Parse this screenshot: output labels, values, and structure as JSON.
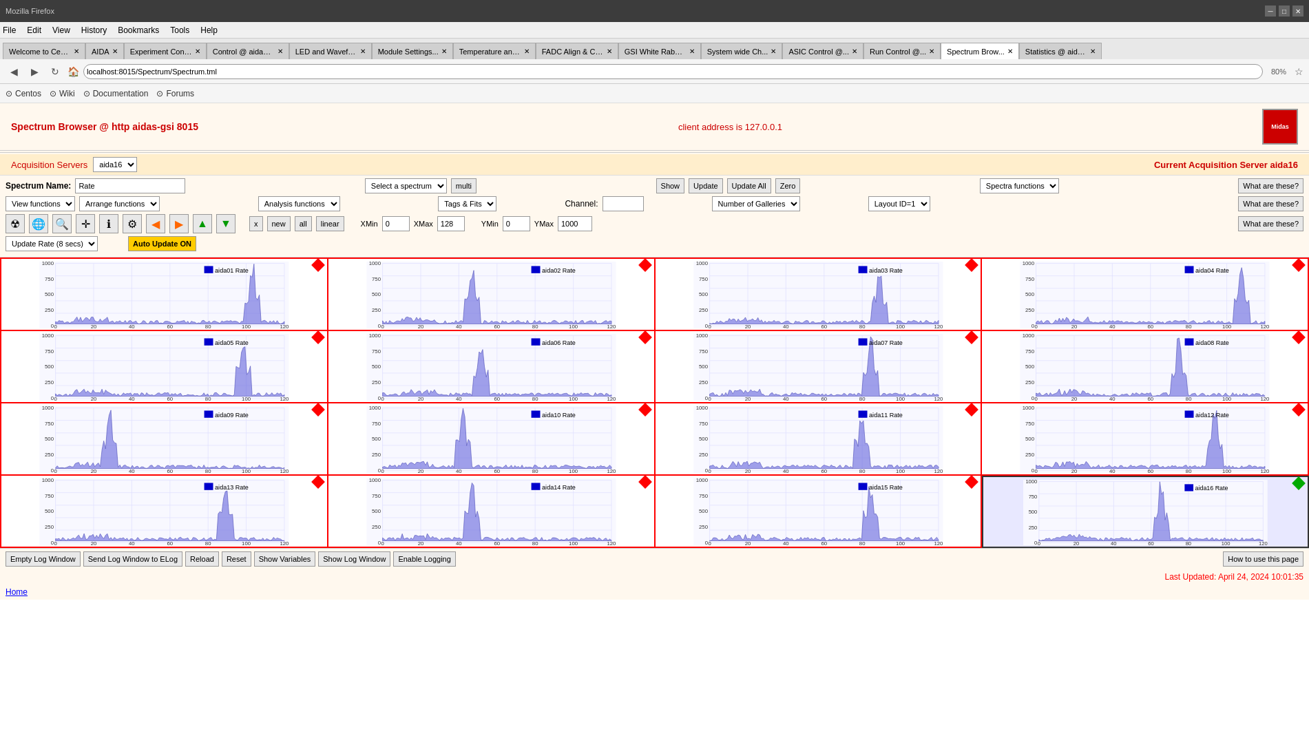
{
  "browser": {
    "menu_items": [
      "File",
      "Edit",
      "View",
      "History",
      "Bookmarks",
      "Tools",
      "Help"
    ],
    "tabs": [
      {
        "label": "Welcome to Cen...",
        "active": false
      },
      {
        "label": "AIDA",
        "active": false
      },
      {
        "label": "Experiment Cont...",
        "active": false
      },
      {
        "label": "Control @ aidas-...",
        "active": false
      },
      {
        "label": "LED and Wavefo...",
        "active": false
      },
      {
        "label": "Module Settings...",
        "active": false
      },
      {
        "label": "Temperature and...",
        "active": false
      },
      {
        "label": "FADC Align & Co...",
        "active": false
      },
      {
        "label": "GSI White Rabbi...",
        "active": false
      },
      {
        "label": "System wide Ch...",
        "active": false
      },
      {
        "label": "ASIC Control @...",
        "active": false
      },
      {
        "label": "Run Control @...",
        "active": false
      },
      {
        "label": "Spectrum Brow...",
        "active": true
      },
      {
        "label": "Statistics @ aida...",
        "active": false
      }
    ],
    "url": "localhost:8015/Spectrum/Spectrum.tml",
    "zoom": "80%",
    "bookmarks": [
      "Centos",
      "Wiki",
      "Documentation",
      "Forums"
    ]
  },
  "page": {
    "title": "Spectrum Browser @ http aidas-gsi 8015",
    "client_address": "client address is 127.0.0.1",
    "logo_line1": "Midas",
    "acq_servers_label": "Acquisition Servers",
    "acq_server_value": "aida16",
    "current_server_label": "Current Acquisition Server aida16",
    "spectrum_name_label": "Spectrum Name:",
    "spectrum_name_value": "Rate",
    "select_spectrum_label": "Select a spectrum",
    "multi_label": "multi",
    "show_label": "Show",
    "update_label": "Update",
    "update_all_label": "Update All",
    "zero_label": "Zero",
    "spectra_functions_label": "Spectra functions",
    "what_are_these": "What are these?",
    "view_functions_label": "View functions",
    "arrange_functions_label": "Arrange functions",
    "analysis_functions_label": "Analysis functions",
    "tags_fits_label": "Tags & Fits",
    "channel_label": "Channel:",
    "channel_value": "",
    "number_of_galleries_label": "Number of Galleries",
    "layout_id_label": "Layout ID=1",
    "xmin_label": "XMin",
    "xmin_value": "0",
    "xmax_label": "XMax",
    "xmax_value": "128",
    "ymin_label": "YMin",
    "ymin_value": "0",
    "ymax_label": "YMax",
    "ymax_value": "1000",
    "x_btn": "x",
    "new_btn": "new",
    "all_btn": "all",
    "linear_btn": "linear",
    "update_rate_label": "Update Rate (8 secs)",
    "auto_update_label": "Auto Update ON",
    "spectra": [
      {
        "id": "aida01",
        "label": "aida01 Rate",
        "diamond": "red"
      },
      {
        "id": "aida02",
        "label": "aida02 Rate",
        "diamond": "red"
      },
      {
        "id": "aida03",
        "label": "aida03 Rate",
        "diamond": "red"
      },
      {
        "id": "aida04",
        "label": "aida04 Rate",
        "diamond": "red"
      },
      {
        "id": "aida05",
        "label": "aida05 Rate",
        "diamond": "red"
      },
      {
        "id": "aida06",
        "label": "aida06 Rate",
        "diamond": "red"
      },
      {
        "id": "aida07",
        "label": "aida07 Rate",
        "diamond": "red"
      },
      {
        "id": "aida08",
        "label": "aida08 Rate",
        "diamond": "red"
      },
      {
        "id": "aida09",
        "label": "aida09 Rate",
        "diamond": "red"
      },
      {
        "id": "aida10",
        "label": "aida10 Rate",
        "diamond": "red"
      },
      {
        "id": "aida11",
        "label": "aida11 Rate",
        "diamond": "red"
      },
      {
        "id": "aida12",
        "label": "aida12 Rate",
        "diamond": "red"
      },
      {
        "id": "aida13",
        "label": "aida13 Rate",
        "diamond": "red"
      },
      {
        "id": "aida14",
        "label": "aida14 Rate",
        "diamond": "red"
      },
      {
        "id": "aida15",
        "label": "aida15 Rate",
        "diamond": "red"
      },
      {
        "id": "aida16",
        "label": "aida16 Rate",
        "diamond": "green",
        "highlighted": true
      }
    ],
    "bottom_buttons": [
      "Empty Log Window",
      "Send Log Window to ELog",
      "Reload",
      "Reset",
      "Show Variables",
      "Show Log Window",
      "Enable Logging"
    ],
    "how_to_use": "How to use this page",
    "last_updated": "Last Updated: April 24, 2024 10:01:35",
    "home_link": "Home"
  }
}
